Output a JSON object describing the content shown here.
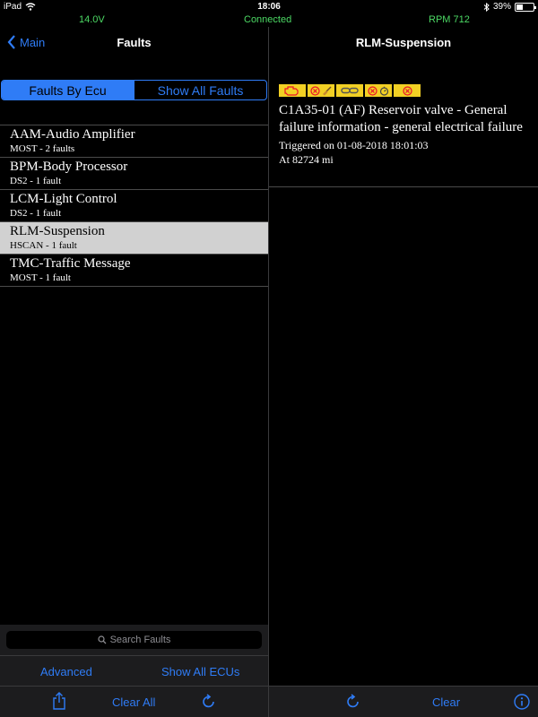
{
  "status_bar": {
    "device": "iPad",
    "time": "18:06",
    "battery": "39%",
    "battery_level": 0.39
  },
  "telemetry": {
    "voltage": "14.0V",
    "connection": "Connected",
    "rpm": "RPM 712"
  },
  "left_nav": {
    "back_label": "Main",
    "title": "Faults"
  },
  "segments": {
    "active": "Faults By Ecu",
    "inactive": "Show All Faults"
  },
  "ecus": [
    {
      "name": "AAM-Audio Amplifier",
      "sub": "MOST - 2 faults"
    },
    {
      "name": "BPM-Body Processor",
      "sub": "DS2 - 1 fault"
    },
    {
      "name": "LCM-Light Control",
      "sub": "DS2 - 1 fault"
    },
    {
      "name": "RLM-Suspension",
      "sub": "HSCAN - 1 fault"
    },
    {
      "name": "TMC-Traffic Message",
      "sub": "MOST - 1 fault"
    }
  ],
  "search": {
    "placeholder": "Search Faults"
  },
  "left_buttons": {
    "advanced": "Advanced",
    "show_all_ecus": "Show All ECUs",
    "clear_all": "Clear All"
  },
  "right_nav": {
    "title": "RLM-Suspension"
  },
  "fault": {
    "description": "C1A35-01 (AF) Reservoir valve - General failure information - general electrical failure",
    "triggered": "Triggered on 01-08-2018 18:01:03",
    "mileage": "At 82724 mi"
  },
  "right_buttons": {
    "clear": "Clear"
  },
  "colors": {
    "accent": "#2f7cf6",
    "telemetry": "#4cd964",
    "warning_badge": "#f2d024",
    "danger": "#e8102a"
  },
  "icons": {
    "fault_status": [
      "engine-check-icon",
      "cancel-icon",
      "broom-icon",
      "chain-link-icon",
      "cancel-icon",
      "timer-icon",
      "cancel-icon"
    ]
  }
}
